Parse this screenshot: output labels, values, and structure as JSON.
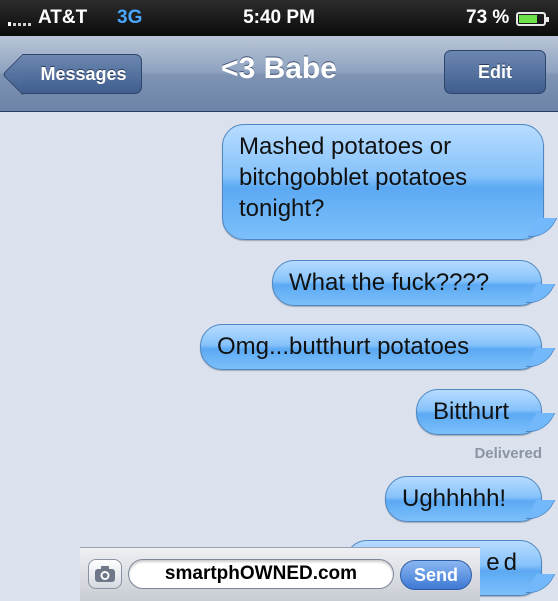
{
  "status_bar": {
    "carrier": "AT&T",
    "network": "3G",
    "time": "5:40 PM",
    "battery_percent": "73 %",
    "battery_level": 0.73
  },
  "nav_bar": {
    "back_label": "Messages",
    "title": "<3 Babe",
    "edit_label": "Edit"
  },
  "messages": [
    {
      "text": "Mashed potatoes or bitchgobblet potatoes tonight?"
    },
    {
      "text": "What the fuck????"
    },
    {
      "text": "Omg...butthurt potatoes"
    },
    {
      "text": "Bitthurt"
    },
    {
      "text": "Ughhhhh!"
    },
    {
      "text": "ed"
    }
  ],
  "delivered_label": "Delivered",
  "watermark": {
    "field_text": "smartphOWNED.com",
    "send_label": "Send",
    "camera_icon": "camera-icon"
  },
  "colors": {
    "bubble": "#86c2fb",
    "nav_bar": "#8ea2bf",
    "background": "#dbe2ed",
    "network": "#49a6ff"
  }
}
